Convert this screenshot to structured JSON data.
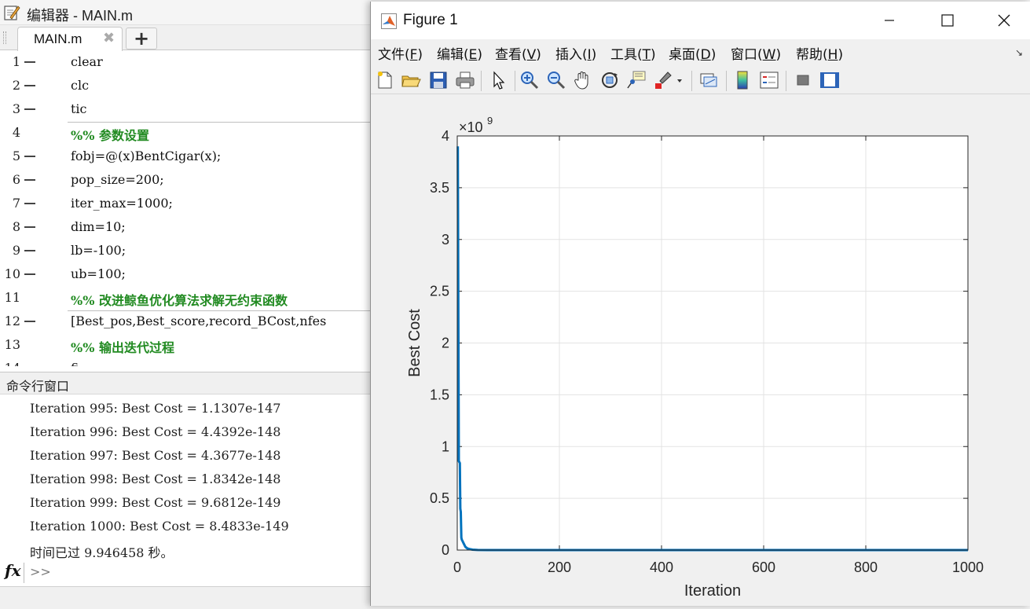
{
  "editor": {
    "title": "编辑器 - MAIN.m",
    "tab_label": "MAIN.m",
    "tab_close": "✖",
    "add_tab": "+",
    "lines": [
      {
        "num": "1",
        "text": "clear",
        "comment": false,
        "cell": false,
        "dash": true
      },
      {
        "num": "2",
        "text": "clc",
        "comment": false,
        "cell": false,
        "dash": true
      },
      {
        "num": "3",
        "text": "tic",
        "comment": false,
        "cell": false,
        "dash": true
      },
      {
        "num": "4",
        "text": "%% 参数设置",
        "comment": true,
        "cell": true,
        "dash": false
      },
      {
        "num": "5",
        "text": "fobj=@(x)BentCigar(x);",
        "comment": false,
        "cell": true,
        "dash": true
      },
      {
        "num": "6",
        "text": "pop_size=200;",
        "comment": false,
        "cell": true,
        "dash": true
      },
      {
        "num": "7",
        "text": "iter_max=1000;",
        "comment": false,
        "cell": true,
        "dash": true
      },
      {
        "num": "8",
        "text": "dim=10;",
        "comment": false,
        "cell": true,
        "dash": true
      },
      {
        "num": "9",
        "text": "lb=-100;",
        "comment": false,
        "cell": true,
        "dash": true
      },
      {
        "num": "10",
        "text": "ub=100;",
        "comment": false,
        "cell": true,
        "dash": true
      },
      {
        "num": "11",
        "text": "%% 改进鲸鱼优化算法求解无约束函数",
        "comment": true,
        "cell": false,
        "dash": false
      },
      {
        "num": "12",
        "text": "[Best_pos,Best_score,record_BCost,nfes",
        "comment": false,
        "cell": false,
        "dash": true
      },
      {
        "num": "13",
        "text": "%% 输出迭代过程",
        "comment": true,
        "cell": false,
        "dash": false
      },
      {
        "num": "14",
        "text": "fi",
        "comment": false,
        "cell": false,
        "dash": true
      }
    ]
  },
  "command_window": {
    "title": "命令行窗口",
    "lines": [
      "Iteration 995: Best Cost = 1.1307e-147",
      "Iteration 996: Best Cost = 4.4392e-148",
      "Iteration 997: Best Cost = 4.3677e-148",
      "Iteration 998: Best Cost = 1.8342e-148",
      "Iteration 999: Best Cost = 9.6812e-149",
      "Iteration 1000: Best Cost = 8.4833e-149",
      "时间已过 9.946458 秒。"
    ],
    "fx_label": "fx",
    "prompt": ">>"
  },
  "figure": {
    "title": "Figure 1",
    "menu": [
      {
        "label": "文件(",
        "key": "F",
        "tail": ")"
      },
      {
        "label": "编辑(",
        "key": "E",
        "tail": ")"
      },
      {
        "label": "查看(",
        "key": "V",
        "tail": ")"
      },
      {
        "label": "插入(",
        "key": "I",
        "tail": ")"
      },
      {
        "label": "工具(",
        "key": "T",
        "tail": ")"
      },
      {
        "label": "桌面(",
        "key": "D",
        "tail": ")"
      },
      {
        "label": "窗口(",
        "key": "W",
        "tail": ")"
      },
      {
        "label": "帮助(",
        "key": "H",
        "tail": ")"
      }
    ],
    "toolbar": [
      "new-figure-icon",
      "open-file-icon",
      "save-icon",
      "print-icon",
      "edit-plot-icon",
      "zoom-in-icon",
      "zoom-out-icon",
      "pan-icon",
      "rotate-3d-icon",
      "data-cursor-icon",
      "brush-icon",
      "link-plot-icon",
      "colorbar-icon",
      "legend-icon",
      "hide-plot-tools-icon",
      "show-plot-tools-icon"
    ]
  },
  "chart_data": {
    "type": "line",
    "title": "",
    "xlabel": "Iteration",
    "ylabel": "Best Cost",
    "exponent_label": "×10",
    "exponent_power": "9",
    "xlim": [
      0,
      1000
    ],
    "ylim": [
      0,
      4
    ],
    "y_scale_note": "×10^9",
    "xticks": [
      0,
      200,
      400,
      600,
      800,
      1000
    ],
    "yticks": [
      0,
      0.5,
      1,
      1.5,
      2,
      2.5,
      3,
      3.5,
      4
    ],
    "ytick_labels": [
      "0",
      "0.5",
      "1",
      "1.5",
      "2",
      "2.5",
      "3",
      "3.5",
      "4"
    ],
    "grid": true,
    "line_color": "#0072BD",
    "series": [
      {
        "x": [
          1,
          2,
          3,
          4,
          5,
          6,
          7,
          8,
          9,
          10,
          12,
          14,
          16,
          20,
          25,
          30,
          40,
          60,
          100,
          200,
          400,
          600,
          800,
          1000
        ],
        "y": [
          3.9,
          2.5,
          0.86,
          0.85,
          0.84,
          0.4,
          0.37,
          0.12,
          0.1,
          0.09,
          0.07,
          0.05,
          0.03,
          0.015,
          0.008,
          0.004,
          0.001,
          0.0003,
          5e-05,
          0,
          0,
          0,
          0,
          0
        ]
      }
    ]
  }
}
